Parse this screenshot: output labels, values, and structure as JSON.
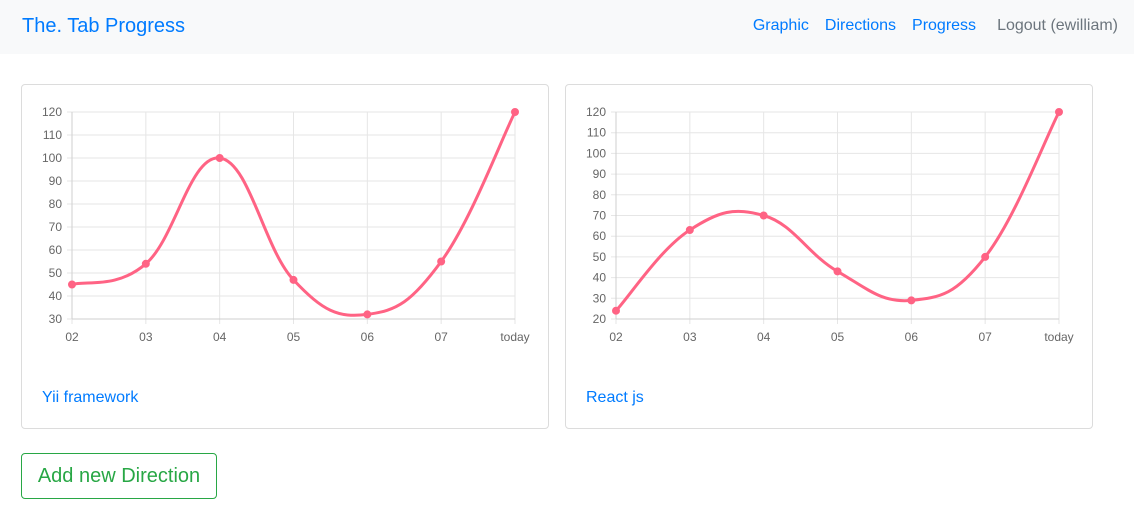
{
  "navbar": {
    "brand": "The. Tab Progress",
    "links": [
      "Graphic",
      "Directions",
      "Progress"
    ],
    "logout": "Logout (ewilliam)"
  },
  "cards": [
    {
      "title": "Yii framework"
    },
    {
      "title": "React js"
    }
  ],
  "add_button": "Add new Direction",
  "colors": {
    "line": "#ff6384",
    "primary": "#007bff",
    "success": "#28a745"
  },
  "chart_data": [
    {
      "type": "line",
      "categories": [
        "02",
        "03",
        "04",
        "05",
        "06",
        "07",
        "today"
      ],
      "values": [
        45,
        54,
        100,
        47,
        32,
        55,
        120
      ],
      "ylim": [
        30,
        120
      ],
      "yticks": [
        30,
        40,
        50,
        60,
        70,
        80,
        90,
        100,
        110,
        120
      ],
      "grid": true
    },
    {
      "type": "line",
      "categories": [
        "02",
        "03",
        "04",
        "05",
        "06",
        "07",
        "today"
      ],
      "values": [
        24,
        63,
        70,
        43,
        29,
        50,
        120
      ],
      "ylim": [
        20,
        120
      ],
      "yticks": [
        20,
        30,
        40,
        50,
        60,
        70,
        80,
        90,
        100,
        110,
        120
      ],
      "grid": true
    }
  ]
}
